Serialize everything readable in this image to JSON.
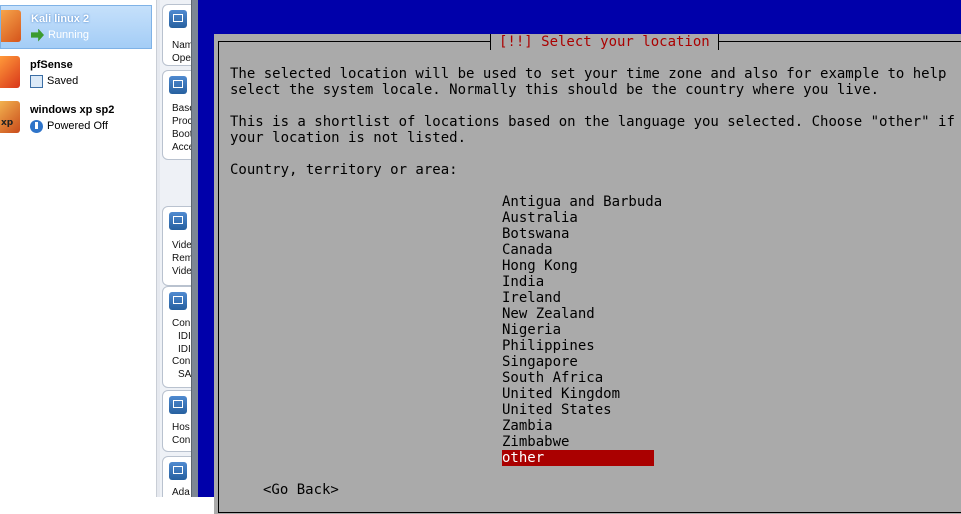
{
  "vm_list": [
    {
      "name": "Kali linux 2",
      "state": "Running",
      "state_icon": "running-arrow-icon",
      "selected": true
    },
    {
      "name": "pfSense",
      "state": "Saved",
      "state_icon": "saved-state-icon",
      "selected": false
    },
    {
      "name": "windows xp sp2",
      "state": "Powered Off",
      "state_icon": "powered-off-icon",
      "selected": false
    }
  ],
  "details": {
    "general": [
      "Nam",
      "Ope"
    ],
    "system": [
      "Base",
      "Proc",
      "Boot",
      "Acce"
    ],
    "display": [
      "Vide",
      "Rem",
      "Vide"
    ],
    "storage": [
      "Con",
      "IDI",
      "IDI",
      "Con",
      "SA"
    ],
    "audio": [
      "Hos",
      "Con"
    ],
    "network": [
      "Ada"
    ]
  },
  "installer": {
    "title": "[!!] Select your location",
    "paragraph1_line1": "The selected location will be used to set your time zone and also for example to help",
    "paragraph1_line2": "select the system locale. Normally this should be the country where you live.",
    "paragraph2_line1": "This is a shortlist of locations based on the language you selected. Choose \"other\" if",
    "paragraph2_line2": "your location is not listed.",
    "prompt": "Country, territory or area:",
    "locations": [
      "Antigua and Barbuda",
      "Australia",
      "Botswana",
      "Canada",
      "Hong Kong",
      "India",
      "Ireland",
      "New Zealand",
      "Nigeria",
      "Philippines",
      "Singapore",
      "South Africa",
      "United Kingdom",
      "United States",
      "Zambia",
      "Zimbabwe",
      "other"
    ],
    "selected_location": "other",
    "go_back": "<Go Back>"
  },
  "colors": {
    "installer_background": "#0000aa",
    "dialog_background": "#aaaaaa",
    "highlight": "#aa0000",
    "selection_blue": "#a4cdf6"
  }
}
